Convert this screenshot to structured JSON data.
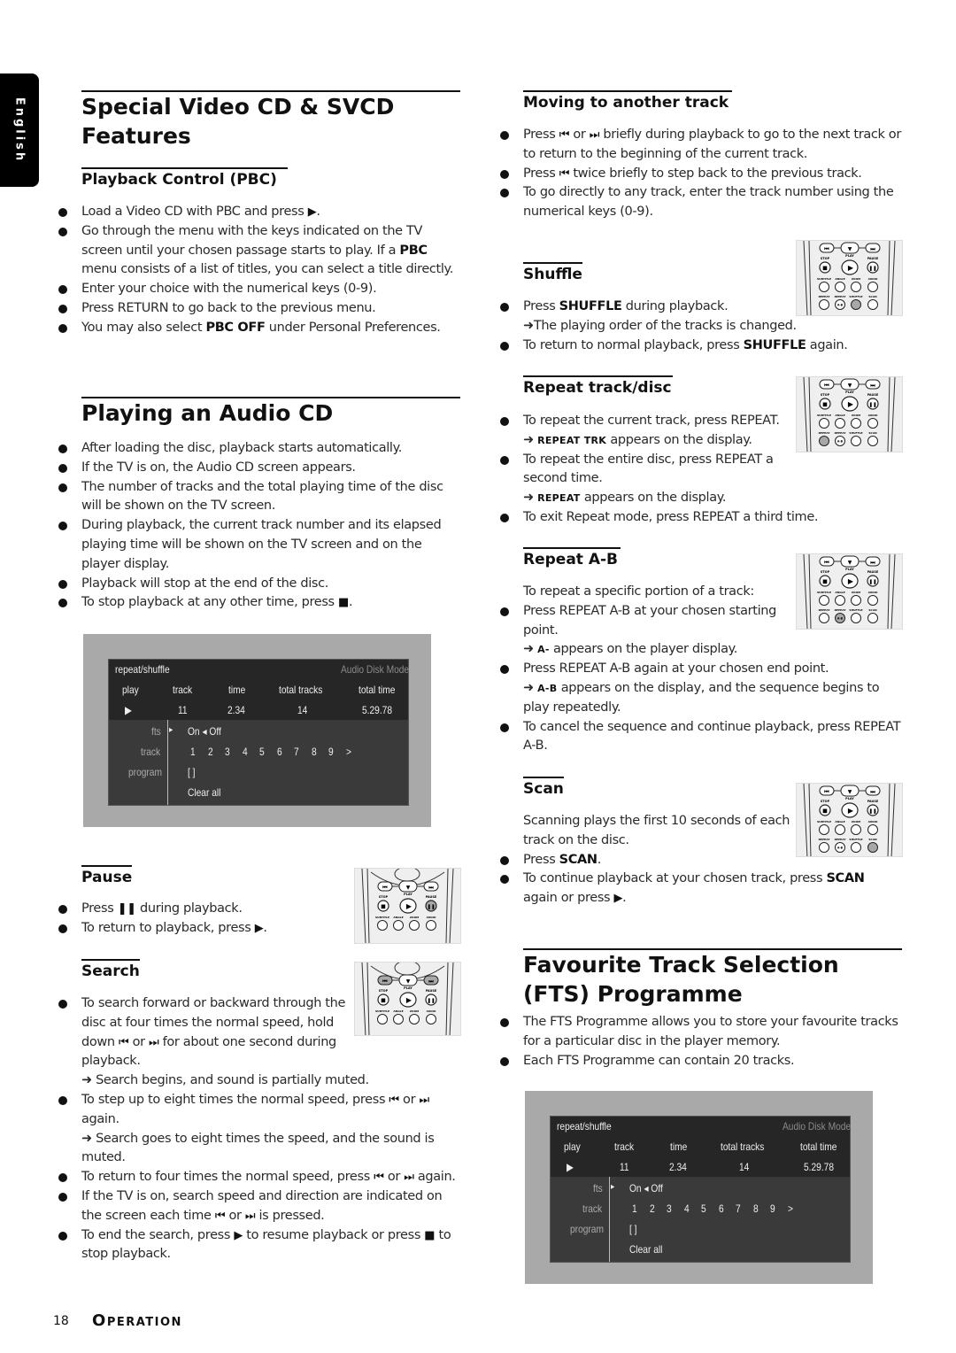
{
  "language_tab": "English",
  "left": {
    "special_vcd": {
      "title_line1": "Special Video CD & SVCD",
      "title_line2": "Features",
      "pbc": {
        "heading": "Playback Control (PBC)",
        "bullets": [
          {
            "text": "Load a Video CD with PBC and press",
            "icon": "play-icon",
            "suffix": "."
          },
          {
            "pre": "Go through the menu with the keys indicated on the TV screen until your chosen passage starts to play. If a ",
            "bold": "PBC",
            "post": " menu consists of a list of titles, you can select a title directly."
          },
          {
            "text": "Enter your choice with the numerical keys (0-9)."
          },
          {
            "text": "Press RETURN to go back to the previous menu."
          },
          {
            "pre": "You may also select ",
            "bold": "PBC OFF",
            "post": " under Personal Preferences."
          }
        ]
      }
    },
    "audio_cd": {
      "title": "Playing an Audio CD",
      "bullets": [
        "After loading the disc, playback starts automatically.",
        "If the TV is on, the Audio CD screen appears.",
        "The number of tracks and the total playing time of the disc will be shown on the TV screen.",
        "During playback, the current track number and its elapsed playing time will be shown on the TV screen and on the player display.",
        "Playback will stop at the end of the disc.",
        "To stop playback at any other time, press"
      ],
      "stop_suffix": "."
    },
    "pause": {
      "heading": "Pause",
      "b1_pre": "Press",
      "b1_post": "during playback.",
      "b2_pre": "To return to playback, press",
      "b2_post": "."
    },
    "search": {
      "heading": "Search",
      "b1_pre": "To search forward or backward through the disc at four times the normal speed, hold down",
      "or": "or",
      "b1_post": "for about one second during playback.",
      "r1": "Search begins, and sound is partially muted.",
      "b2_pre": "To step up to eight times the normal speed, press",
      "again": "again.",
      "r2": "Search goes to eight times the speed, and the sound is muted.",
      "b3_pre": "To return to four times the normal speed, press",
      "b4_pre": "If the TV is on, search speed and direction are indicated on the screen each time",
      "b4_post": "is pressed.",
      "b5_pre": "To end the search, press",
      "b5_mid": "to resume playback or press",
      "b5_post": "to stop playback."
    }
  },
  "right": {
    "moving": {
      "heading": "Moving to another track",
      "b1_pre": "Press",
      "or": "or",
      "b1_post": "briefly during playback to go to the next track or to return to the beginning of the current track.",
      "b2_pre": "Press",
      "b2_post": "twice briefly to step back to the previous track.",
      "b3": "To go directly to any track, enter the track number using the numerical keys (0-9)."
    },
    "shuffle": {
      "heading": "Shuffle",
      "b1_pre": "Press ",
      "b1_bold": "SHUFFLE",
      "b1_post": " during playback.",
      "r1": "The playing order of the tracks is changed.",
      "b2_pre": "To return to normal playback, press ",
      "b2_bold": "SHUFFLE",
      "b2_post": " again."
    },
    "repeat": {
      "heading": "Repeat track/disc",
      "b1": "To repeat the current track, press REPEAT.",
      "r1_sc": "REPEAT TRK",
      "r1_post": " appears on the display.",
      "b2": "To repeat the entire disc, press REPEAT a second time.",
      "r2_sc": "REPEAT",
      "r2_post": " appears on the display.",
      "b3": "To exit Repeat mode, press REPEAT a third time."
    },
    "repeat_ab": {
      "heading": "Repeat A-B",
      "intro": "To repeat a specific portion of a track:",
      "b1": "Press REPEAT A-B at your chosen starting point.",
      "r1_sc": "A-",
      "r1_post": " appears on the player display.",
      "b2": "Press REPEAT A-B again at your chosen end point.",
      "r2_sc": "A-B",
      "r2_post": " appears on the display, and the sequence begins to play repeatedly.",
      "b3": "To cancel the sequence and continue playback, press REPEAT A-B."
    },
    "scan": {
      "heading": "Scan",
      "intro": "Scanning plays the first 10 seconds of each track on the disc.",
      "b1_pre": "Press ",
      "b1_bold": "SCAN",
      "b1_post": ".",
      "b2_pre": "To continue playback at your chosen track, press ",
      "b2_bold": "SCAN",
      "b2_post": " again or press",
      "b2_end": "."
    },
    "fts": {
      "title_line1": "Favourite Track Selection",
      "title_line2": "(FTS) Programme",
      "bullets": [
        "The FTS Programme allows you to store your favourite tracks for a particular disc in the player memory.",
        "Each FTS Programme can contain 20 tracks."
      ]
    }
  },
  "tv_screen": {
    "menu_title": "repeat/shuffle",
    "mode": "Audio Disk Mode",
    "columns": [
      "play",
      "track",
      "time",
      "total tracks",
      "total time"
    ],
    "values": {
      "track": "11",
      "time": "2.34",
      "total_tracks": "14",
      "total_time": "5.29.78"
    },
    "rows": {
      "fts_label": "fts",
      "fts_value": "On ◂ Off",
      "track_label": "track",
      "track_numbers": [
        "1",
        "2",
        "3",
        "4",
        "5",
        "6",
        "7",
        "8",
        "9",
        ">"
      ],
      "program_label": "program",
      "program_value": "[ ]",
      "clear_all": "Clear all"
    }
  },
  "remote": {
    "labels": {
      "stop": "STOP",
      "play": "PLAY",
      "pause": "PAUSE",
      "subtitle": "SUBTITLE",
      "angle": "ANGLE",
      "zoom": "ZOOM",
      "audio": "AUDIO",
      "repeat": "REPEAT",
      "repeat_ab": "REPEAT",
      "shuffle": "SHUFFLE",
      "scan": "SCAN",
      "ab": "A-B"
    },
    "highlight_color": "#a8a8a8"
  },
  "footer": {
    "page": "18",
    "section_cap": "O",
    "section_rest": "PERATION"
  }
}
